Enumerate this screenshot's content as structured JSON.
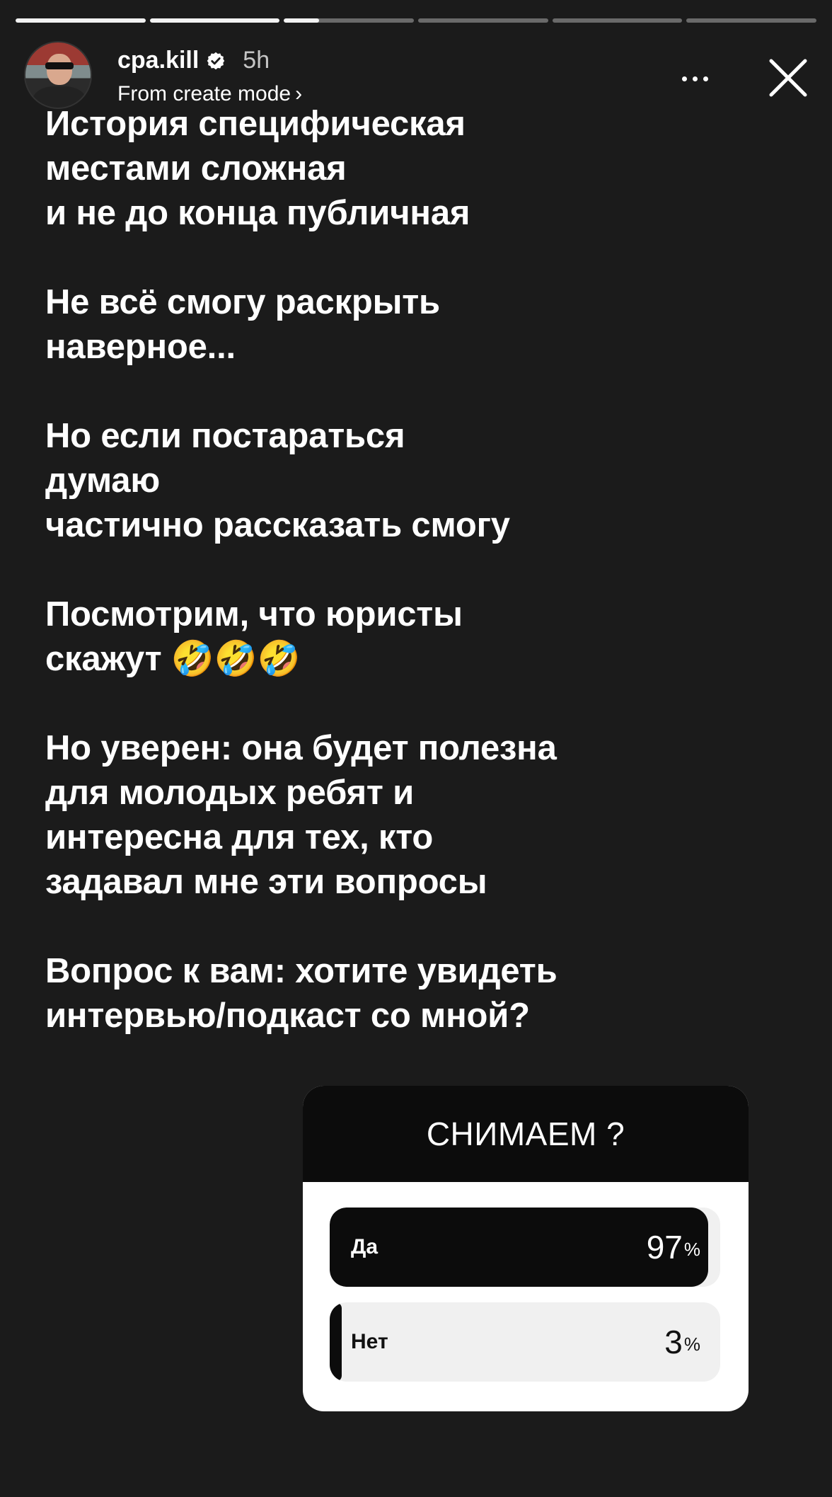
{
  "progress": {
    "segments": [
      1,
      1,
      0.27,
      0,
      0,
      0
    ]
  },
  "header": {
    "username": "cpa.kill",
    "time": "5h",
    "subtitle": "From create mode",
    "subtitle_chevron": "›"
  },
  "story_text": {
    "paragraphs": [
      [
        "История специфическая",
        "местами сложная",
        "и не до конца публичная"
      ],
      [
        "Не всё смогу раскрыть",
        "наверное..."
      ],
      [
        "Но если постараться",
        "думаю",
        "частично рассказать смогу"
      ],
      [
        "Посмотрим, что юристы",
        "скажут 🤣🤣🤣"
      ],
      [
        "Но уверен: она будет полезна",
        "для молодых ребят и",
        "интересна для тех, кто",
        "задавал мне эти вопросы"
      ],
      [
        "Вопрос к вам: хотите увидеть",
        "интервью/подкаст со мной?"
      ]
    ]
  },
  "poll": {
    "question": "СНИМАЕМ ?",
    "options": [
      {
        "label": "Да",
        "percent": 97,
        "percent_text": "97",
        "sign": "%"
      },
      {
        "label": "Нет",
        "percent": 3,
        "percent_text": "3",
        "sign": "%"
      }
    ]
  },
  "icons": {
    "verified": "verified-badge-icon",
    "more": "more-options-icon",
    "close": "close-icon"
  }
}
